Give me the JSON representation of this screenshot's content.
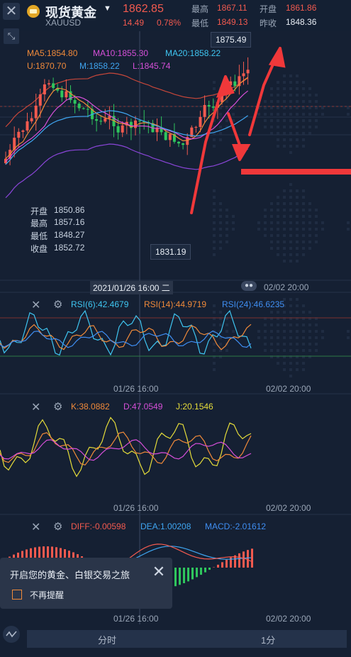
{
  "header": {
    "close_icon": "close-icon",
    "title": "现货黄金",
    "symbol": "XAUUSD",
    "price": "1862.85",
    "change": "14.49",
    "change_pct": "0.78%",
    "high_label": "最高",
    "high": "1867.11",
    "open_label": "开盘",
    "open": "1861.86",
    "low_label": "最低",
    "low": "1849.13",
    "prev_label": "昨收",
    "prev": "1848.36"
  },
  "main_chart": {
    "ma5": "MA5:1854.80",
    "ma10": "MA10:1855.30",
    "ma20": "MA20:1858.22",
    "boll_u": "U:1870.70",
    "boll_m": "M:1858.22",
    "boll_l": "L:1845.74",
    "high_tag": "1875.49",
    "low_tag": "1831.19",
    "ohlc": {
      "open_label": "开盘",
      "open": "1850.86",
      "high_label": "最高",
      "high": "1857.16",
      "low_label": "最低",
      "low": "1848.27",
      "close_label": "收盘",
      "close": "1852.72"
    },
    "cursor_time": "2021/01/26 16:00 二",
    "right_time": "02/02 20:00"
  },
  "rsi": {
    "rsi6": "RSI(6):42.4679",
    "rsi14": "RSI(14):44.9719",
    "rsi24": "RSI(24):46.6235",
    "left_time": "01/26 16:00",
    "right_time": "02/02 20:00"
  },
  "kdj": {
    "k": "K:38.0882",
    "d": "D:47.0549",
    "j": "J:20.1546",
    "left_time": "01/26 16:00",
    "right_time": "02/02 20:00"
  },
  "macd": {
    "diff": "DIFF:-0.00598",
    "dea": "DEA:1.00208",
    "macd": "MACD:-2.01612",
    "left_time": "01/26 16:00",
    "right_time": "02/02 20:00"
  },
  "popup": {
    "text": "开启您的黄金、白银交易之旅",
    "checkbox_label": "不再提醒"
  },
  "bottom_tabs": [
    "分时",
    "1分"
  ],
  "colors": {
    "up": "#f25a4f",
    "down": "#2fc55d",
    "ma5": "#f08a3a",
    "ma10": "#d64fd8",
    "ma20": "#3fa6f2",
    "annotation": "#f0383a"
  }
}
